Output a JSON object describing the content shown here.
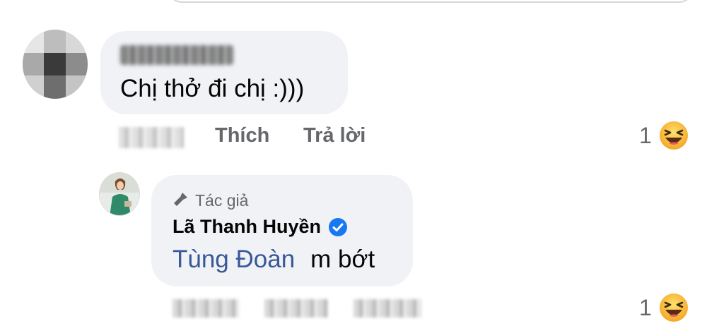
{
  "comment": {
    "author_name_blurred": "Tùng Đoàn",
    "text": "Chị thở đi chị :)))",
    "time_blurred": "1 ngày",
    "like_label": "Thích",
    "reply_label": "Trả lời",
    "reaction_count": "1",
    "reaction_icon": "laughing-emoji-icon"
  },
  "reply": {
    "badge_label": "Tác giả",
    "badge_icon": "microphone-icon",
    "author_name": "Lã Thanh Huyền",
    "verified_icon": "verified-badge-icon",
    "mention": "Tùng Đoàn",
    "text": "m bớt",
    "time_blurred": "1 ngày",
    "like_label_blurred": "Thích",
    "reply_label_blurred": "Trả lời",
    "reaction_count": "1",
    "reaction_icon": "laughing-emoji-icon"
  },
  "colors": {
    "bubble_bg": "#f0f2f5",
    "primary_text": "#050505",
    "secondary_text": "#65676b",
    "mention": "#385898",
    "verified_blue": "#1877f2",
    "emoji_yellow": "#f7b928"
  }
}
